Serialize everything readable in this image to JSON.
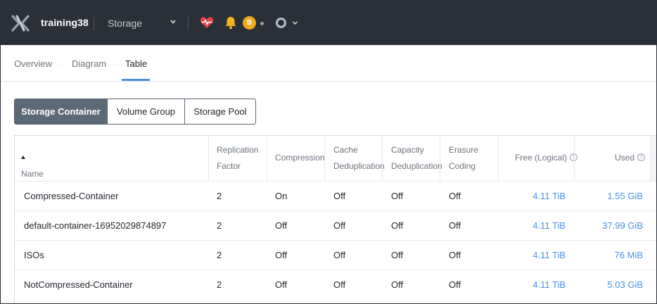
{
  "topbar": {
    "cluster_name": "training38",
    "app_menu_label": "Storage",
    "badge_letter": "B",
    "colors": {
      "bar": "#2b3038",
      "health": "#e8414a",
      "bell": "#f0b31a",
      "badge": "#f0a81e"
    }
  },
  "subnav": {
    "tabs": [
      {
        "label": "Overview"
      },
      {
        "label": "Diagram"
      },
      {
        "label": "Table"
      }
    ],
    "separator": "·",
    "active_tab": "Table"
  },
  "entity_tabs": [
    {
      "label": "Storage Container"
    },
    {
      "label": "Volume Group"
    },
    {
      "label": "Storage Pool"
    }
  ],
  "table": {
    "headers": {
      "name": "Name",
      "replication_1": "Replication",
      "replication_2": "Factor",
      "compression": "Compression",
      "cache_1": "Cache",
      "cache_2": "Deduplication",
      "capacity_1": "Capacity",
      "capacity_2": "Deduplication",
      "erasure_1": "Erasure",
      "erasure_2": "Coding",
      "free": "Free (Logical)",
      "used": "Used",
      "help_glyph": "?"
    },
    "rows": [
      {
        "name": "Compressed-Container",
        "rf": "2",
        "compression": "On",
        "cache_dedup": "Off",
        "capacity_dedup": "Off",
        "erasure": "Off",
        "free": "4.11 TiB",
        "used": "1.55 GiB"
      },
      {
        "name": "default-container-16952029874897",
        "rf": "2",
        "compression": "Off",
        "cache_dedup": "Off",
        "capacity_dedup": "Off",
        "erasure": "Off",
        "free": "4.11 TiB",
        "used": "37.99 GiB"
      },
      {
        "name": "ISOs",
        "rf": "2",
        "compression": "Off",
        "cache_dedup": "Off",
        "capacity_dedup": "Off",
        "erasure": "Off",
        "free": "4.11 TiB",
        "used": "76 MiB"
      },
      {
        "name": "NotCompressed-Container",
        "rf": "2",
        "compression": "Off",
        "cache_dedup": "Off",
        "capacity_dedup": "Off",
        "erasure": "Off",
        "free": "4.11 TiB",
        "used": "5.03 GiB"
      }
    ]
  }
}
